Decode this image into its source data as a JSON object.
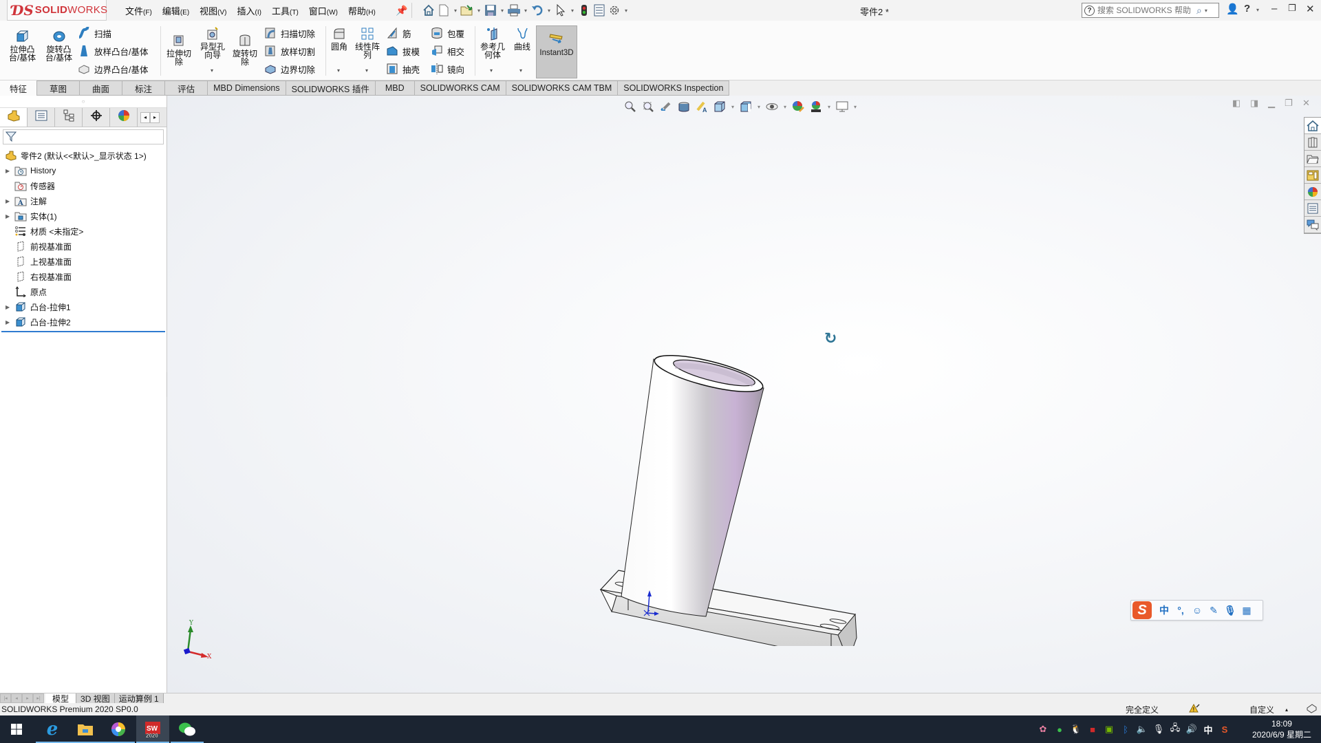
{
  "app": {
    "brand_prefix": "SOLID",
    "brand_suffix": "WORKS",
    "document_title": "零件2 *"
  },
  "menu": [
    {
      "label": "文件",
      "key": "(F)"
    },
    {
      "label": "编辑",
      "key": "(E)"
    },
    {
      "label": "视图",
      "key": "(V)"
    },
    {
      "label": "插入",
      "key": "(I)"
    },
    {
      "label": "工具",
      "key": "(T)"
    },
    {
      "label": "窗口",
      "key": "(W)"
    },
    {
      "label": "帮助",
      "key": "(H)"
    }
  ],
  "quick_access": [
    "home-icon",
    "new-document-icon",
    "open-icon",
    "save-icon",
    "print-icon",
    "undo-icon",
    "select-icon",
    "rebuild-icon",
    "file-properties-icon",
    "options-icon"
  ],
  "help_search": {
    "placeholder": "搜索 SOLIDWORKS 帮助"
  },
  "ribbon": {
    "extruded_boss": "拉伸凸\n台/基体",
    "revolved_boss": "旋转凸\n台/基体",
    "sweep": "扫描",
    "loft_boss": "放样凸台/基体",
    "boundary_boss": "边界凸台/基体",
    "extruded_cut": "拉伸切\n除",
    "hole_wizard": "异型孔\n向导",
    "revolved_cut": "旋转切\n除",
    "swept_cut": "扫描切除",
    "lofted_cut": "放样切割",
    "boundary_cut": "边界切除",
    "fillet": "圆角",
    "linear_pattern": "线性阵\n列",
    "rib": "筋",
    "draft": "拔模",
    "shell": "抽壳",
    "wrap": "包覆",
    "intersect": "相交",
    "mirror": "镜向",
    "reference_geometry": "参考几\n何体",
    "curves": "曲线",
    "instant3d": "Instant3D"
  },
  "command_tabs": [
    {
      "label": "特征",
      "active": true
    },
    {
      "label": "草图"
    },
    {
      "label": "曲面"
    },
    {
      "label": "标注"
    },
    {
      "label": "评估"
    },
    {
      "label": "MBD Dimensions"
    },
    {
      "label": "SOLIDWORKS 插件"
    },
    {
      "label": "MBD"
    },
    {
      "label": "SOLIDWORKS CAM"
    },
    {
      "label": "SOLIDWORKS CAM TBM"
    },
    {
      "label": "SOLIDWORKS Inspection"
    }
  ],
  "feature_tree": {
    "root": "零件2  (默认<<默认>_显示状态 1>)",
    "items": [
      {
        "label": "History",
        "icon": "history-folder-icon",
        "expandable": true
      },
      {
        "label": "传感器",
        "icon": "sensors-folder-icon",
        "expandable": false
      },
      {
        "label": "注解",
        "icon": "annotations-folder-icon",
        "expandable": true
      },
      {
        "label": "实体(1)",
        "icon": "solid-bodies-folder-icon",
        "expandable": true
      },
      {
        "label": "材质 <未指定>",
        "icon": "material-icon",
        "expandable": false
      },
      {
        "label": "前视基准面",
        "icon": "plane-icon",
        "expandable": false
      },
      {
        "label": "上视基准面",
        "icon": "plane-icon",
        "expandable": false
      },
      {
        "label": "右视基准面",
        "icon": "plane-icon",
        "expandable": false
      },
      {
        "label": "原点",
        "icon": "origin-icon",
        "expandable": false
      },
      {
        "label": "凸台-拉伸1",
        "icon": "extrude-feature-icon",
        "expandable": true
      },
      {
        "label": "凸台-拉伸2",
        "icon": "extrude-feature-icon",
        "expandable": true
      }
    ]
  },
  "bottom_tabs": [
    {
      "label": "模型",
      "active": true
    },
    {
      "label": "3D 视图"
    },
    {
      "label": "运动算例 1"
    }
  ],
  "status": {
    "product": "SOLIDWORKS Premium 2020 SP0.0",
    "definition": "完全定义",
    "units": "自定义"
  },
  "triad": {
    "x": "X",
    "y": "Y"
  },
  "ime": {
    "mode": "中",
    "punct": "°,"
  },
  "taskbar": {
    "apps": [
      "windows-start",
      "internet-explorer",
      "file-explorer",
      "browser",
      "solidworks-2020",
      "wechat"
    ],
    "sw_badge": "2020",
    "tray_lang": "中",
    "time": "18:09",
    "date": "2020/6/9 星期二"
  }
}
